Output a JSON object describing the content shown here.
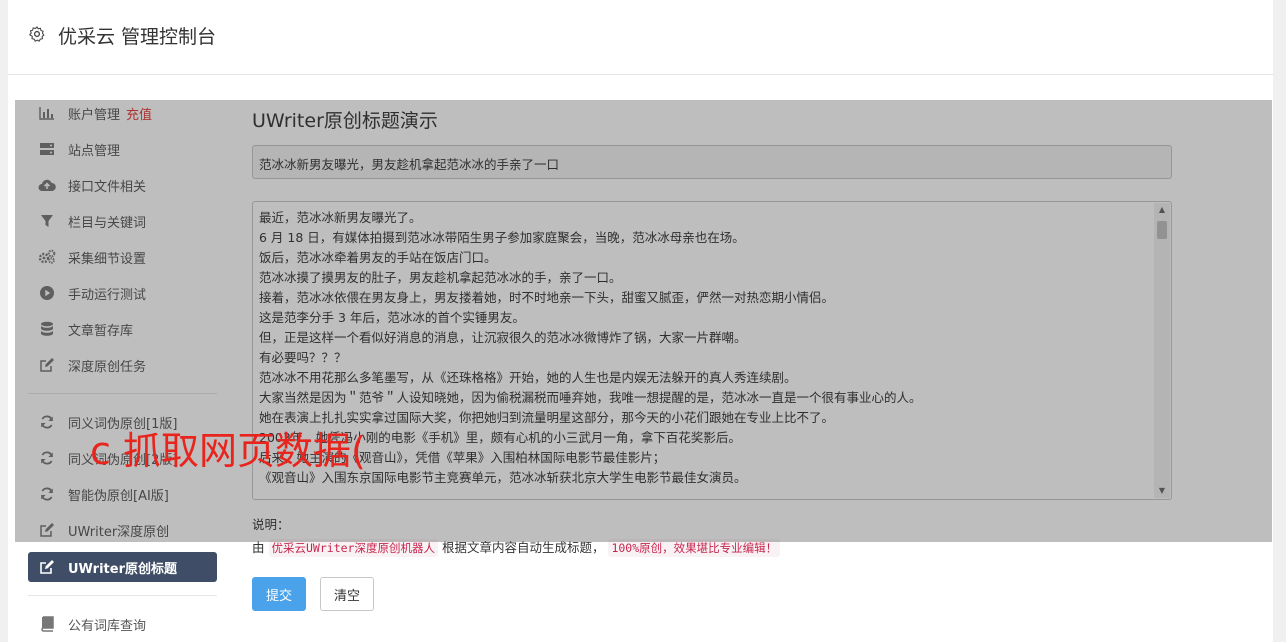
{
  "header": {
    "title": "优采云 管理控制台",
    "icon": "gear-icon"
  },
  "sidebar": {
    "items": [
      {
        "label": "账户管理",
        "badge": "充值",
        "icon": "bar-chart-icon"
      },
      {
        "label": "站点管理",
        "icon": "server-icon"
      },
      {
        "label": "接口文件相关",
        "icon": "cloud-upload-icon"
      },
      {
        "label": "栏目与关键词",
        "icon": "filter-icon"
      },
      {
        "label": "采集细节设置",
        "icon": "cogs-icon"
      },
      {
        "label": "手动运行测试",
        "icon": "play-circle-icon"
      },
      {
        "label": "文章暂存库",
        "icon": "database-icon"
      },
      {
        "label": "深度原创任务",
        "icon": "edit-icon"
      },
      {
        "label": "同义词伪原创[1版]",
        "icon": "refresh-icon"
      },
      {
        "label": "同义词伪原创[2版]",
        "icon": "refresh-icon"
      },
      {
        "label": "智能伪原创[AI版]",
        "icon": "refresh-icon"
      },
      {
        "label": "UWriter深度原创",
        "icon": "edit-icon"
      },
      {
        "label": "UWriter原创标题",
        "icon": "edit-icon",
        "active": true
      },
      {
        "label": "公有词库查询",
        "icon": "book-icon"
      }
    ]
  },
  "main": {
    "title": "UWriter原创标题演示",
    "title_input_value": "范冰冰新男友曝光，男友趁机拿起范冰冰的手亲了一口",
    "content_lines": [
      "最近，范冰冰新男友曝光了。",
      "6 月 18 日，有媒体拍摄到范冰冰带陌生男子参加家庭聚会，当晚，范冰冰母亲也在场。",
      "饭后，范冰冰牵着男友的手站在饭店门口。",
      "范冰冰摸了摸男友的肚子，男友趁机拿起范冰冰的手，亲了一口。",
      "接着，范冰冰依偎在男友身上，男友搂着她，时不时地亲一下头，甜蜜又腻歪，俨然一对热恋期小情侣。",
      "这是范李分手 3 年后，范冰冰的首个实锤男友。",
      "但，正是这样一个看似好消息的消息，让沉寂很久的范冰冰微博炸了锅，大家一片群嘲。",
      "有必要吗？？？",
      "范冰冰不用花那么多笔墨写，从《还珠格格》开始，她的人生也是内娱无法躲开的真人秀连续剧。",
      "大家当然是因为＂范爷＂人设知晓她，因为偷税漏税而唾弃她，我唯一想提醒的是，范冰冰一直是一个很有事业心的人。",
      "她在表演上扎扎实实拿过国际大奖，你把她归到流量明星这部分，那今天的小花们跟她在专业上比不了。",
      "2003年，她凭冯小刚的电影《手机》里，颇有心机的小三武月一角，拿下百花奖影后。",
      "后来，她主演的《观音山》，凭借《苹果》入围柏林国际电影节最佳影片；",
      "《观音山》入围东京国际电影节主竞赛单元，范冰冰斩获北京大学生电影节最佳女演员。"
    ],
    "description_label": "说明：",
    "description_prefix": "由",
    "description_product": "优采云UWriter深度原创机器人",
    "description_middle": "根据文章内容自动生成标题，",
    "description_highlight": "100%原创，效果堪比专业编辑！",
    "submit_label": "提交",
    "clear_label": "清空"
  },
  "watermark": "c 抓取网页数据(",
  "colors": {
    "accent": "#4aa3ea",
    "active_nav": "#3f4d66",
    "badge": "#e53935",
    "code": "#c7254e",
    "watermark": "#e8241c"
  }
}
